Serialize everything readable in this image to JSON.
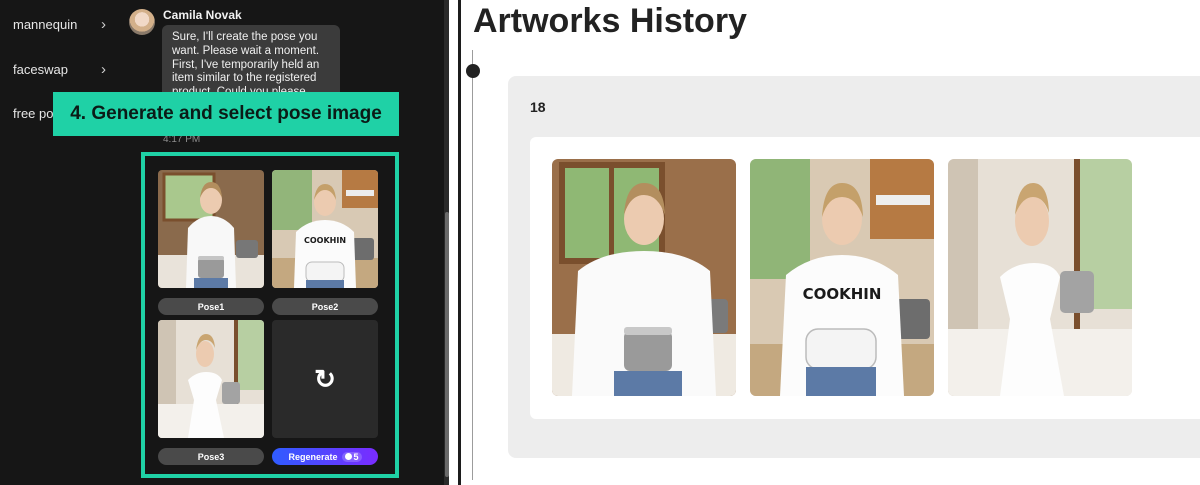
{
  "sidebar": {
    "items": [
      {
        "label": "mannequin",
        "chevron": "›"
      },
      {
        "label": "faceswap",
        "chevron": "›"
      },
      {
        "label": "free po",
        "chevron": ""
      }
    ]
  },
  "chat": {
    "sender": "Camila Novak",
    "message": "Sure, I'll create the pose you want. Please wait a moment. First, I've temporarily held an item similar to the registered product. Could you please",
    "time": "4:17 PM"
  },
  "callout": {
    "text": "4. Generate and select pose image"
  },
  "poses": {
    "items": [
      {
        "label": "Pose1",
        "shirt_text": ""
      },
      {
        "label": "Pose2",
        "shirt_text": "COOKHIN"
      },
      {
        "label": "Pose3",
        "shirt_text": ""
      }
    ],
    "regenerate_icon": "↻",
    "regenerate_label": "Regenerate",
    "regenerate_credits": "5"
  },
  "history": {
    "title": "Artworks History",
    "count": "18",
    "images": [
      {
        "name": "woman-white-shirt-pot",
        "shirt_text": ""
      },
      {
        "name": "woman-cookhin-tshirt-pot",
        "shirt_text": "COOKHIN"
      },
      {
        "name": "woman-white-dress-pot",
        "shirt_text": ""
      }
    ]
  },
  "colors": {
    "accent": "#1fd1a6",
    "regenerate_gradient_start": "#2f5cff",
    "regenerate_gradient_end": "#7a2cff",
    "dark_panel": "#161616"
  }
}
